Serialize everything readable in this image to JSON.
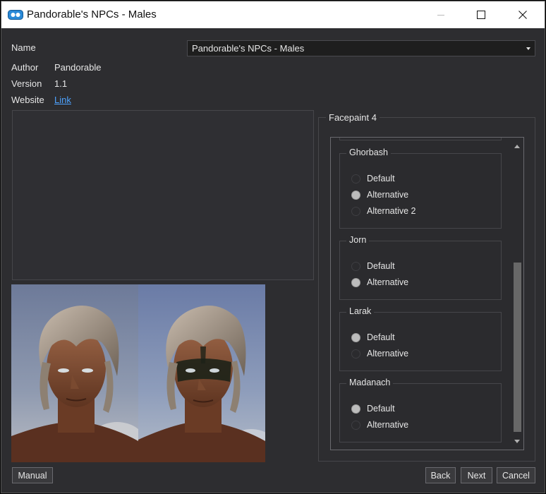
{
  "window": {
    "title": "Pandorable's NPCs - Males",
    "controls": {
      "minimize": "minimize",
      "maximize": "maximize",
      "close": "close"
    }
  },
  "info": {
    "name_label": "Name",
    "name_value": "Pandorable's NPCs - Males",
    "author_label": "Author",
    "author_value": "Pandorable",
    "version_label": "Version",
    "version_value": "1.1",
    "website_label": "Website",
    "website_link": "Link"
  },
  "options": {
    "group_title": "Facepaint 4",
    "groups": [
      {
        "title": "Ghorbash",
        "choices": [
          {
            "label": "Default",
            "checked": false
          },
          {
            "label": "Alternative",
            "checked": true
          },
          {
            "label": "Alternative 2",
            "checked": false
          }
        ]
      },
      {
        "title": "Jorn",
        "choices": [
          {
            "label": "Default",
            "checked": false
          },
          {
            "label": "Alternative",
            "checked": true
          }
        ]
      },
      {
        "title": "Larak",
        "choices": [
          {
            "label": "Default",
            "checked": true
          },
          {
            "label": "Alternative",
            "checked": false
          }
        ]
      },
      {
        "title": "Madanach",
        "choices": [
          {
            "label": "Default",
            "checked": true
          },
          {
            "label": "Alternative",
            "checked": false
          }
        ]
      }
    ]
  },
  "buttons": {
    "manual": "Manual",
    "back": "Back",
    "next": "Next",
    "cancel": "Cancel"
  },
  "colors": {
    "background": "#2d2d30",
    "link": "#4ea3ff",
    "radio_checked": "#bcbcbc"
  }
}
